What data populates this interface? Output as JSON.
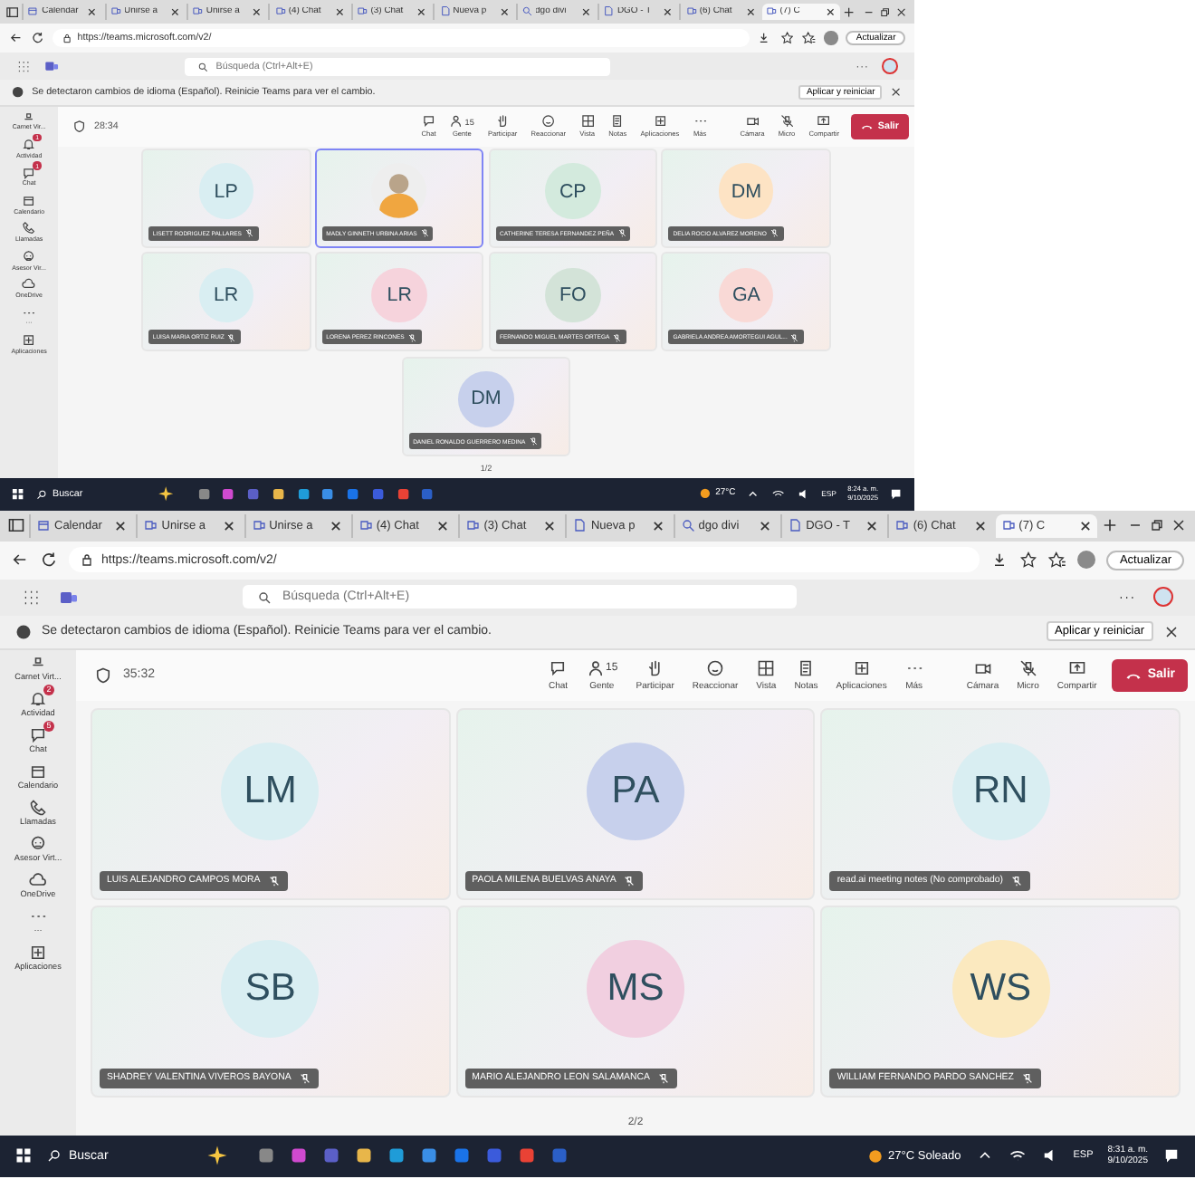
{
  "screens": [
    {
      "tabs": [
        {
          "label": "Calendar",
          "selected": false
        },
        {
          "label": "Unirse a",
          "selected": false
        },
        {
          "label": "Unirse a",
          "selected": false
        },
        {
          "label": "(4) Chat",
          "selected": false
        },
        {
          "label": "(3) Chat",
          "selected": false
        },
        {
          "label": "Nueva p",
          "selected": false
        },
        {
          "label": "dgo divi",
          "selected": false
        },
        {
          "label": "DGO - T",
          "selected": false
        },
        {
          "label": "(6) Chat",
          "selected": false
        },
        {
          "label": "(7) C",
          "selected": true
        }
      ],
      "url": "https://teams.microsoft.com/v2/",
      "update_button": "Actualizar",
      "search_placeholder": "Búsqueda (Ctrl+Alt+E)",
      "notice": "Se detectaron cambios de idioma (Español). Reinicie Teams para ver el cambio.",
      "notice_button": "Aplicar y reiniciar",
      "rail": [
        {
          "label": "Carnet Vir..."
        },
        {
          "label": "Actividad",
          "badge": "1"
        },
        {
          "label": "Chat",
          "badge": "1"
        },
        {
          "label": "Calendario"
        },
        {
          "label": "Llamadas"
        },
        {
          "label": "Asesor Vir..."
        },
        {
          "label": "OneDrive"
        },
        {
          "label": "···"
        },
        {
          "label": "Aplicaciones"
        }
      ],
      "timer": "28:34",
      "toolbar": [
        {
          "label": "Chat"
        },
        {
          "label": "Gente",
          "count": "15"
        },
        {
          "label": "Participar"
        },
        {
          "label": "Reaccionar"
        },
        {
          "label": "Vista"
        },
        {
          "label": "Notas"
        },
        {
          "label": "Aplicaciones"
        },
        {
          "label": "Más"
        },
        {
          "label": "Cámara"
        },
        {
          "label": "Micro"
        },
        {
          "label": "Compartir"
        }
      ],
      "leave_button": "Salir",
      "tiles": [
        {
          "kind": "initials",
          "initials": "LP",
          "name": "LISETT RODRIGUEZ PALLARES",
          "color": "#d9eef2",
          "selected": false
        },
        {
          "kind": "photo",
          "name": "MADLY GINNETH URBINA ARIAS",
          "color": "#f0a640",
          "selected": true
        },
        {
          "kind": "initials",
          "initials": "CP",
          "name": "CATHERINE TERESA FERNANDEZ PEÑA",
          "color": "#d3eadd",
          "selected": false
        },
        {
          "kind": "initials",
          "initials": "DM",
          "name": "DELIA ROCIO ALVAREZ MORENO",
          "color": "#fde3c4",
          "selected": false
        },
        {
          "kind": "initials",
          "initials": "LR",
          "name": "LUISA MARIA ORTIZ RUIZ",
          "color": "#d9eef2",
          "selected": false
        },
        {
          "kind": "initials",
          "initials": "LR",
          "name": "LORENA PEREZ RINCONES",
          "color": "#f6d3dc",
          "selected": false
        },
        {
          "kind": "initials",
          "initials": "FO",
          "name": "FERNANDO MIGUEL MARTES ORTEGA",
          "color": "#d3e3d8",
          "selected": false
        },
        {
          "kind": "initials",
          "initials": "GA",
          "name": "GABRIELA ANDREA AMORTEGUI AGUL...",
          "color": "#f9d9d6",
          "selected": false
        },
        {
          "kind": "initials",
          "initials": "DM",
          "name": "DANIEL RONALDO GUERRERO MEDINA",
          "color": "#c7d0ec",
          "selected": false
        }
      ],
      "pager": "1/2",
      "taskbar_search": "Buscar",
      "weather": "27°C",
      "language": "ESP",
      "time": "8:24 a. m.",
      "date": "9/10/2025"
    },
    {
      "tabs": [
        {
          "label": "Calendar",
          "selected": false
        },
        {
          "label": "Unirse a",
          "selected": false
        },
        {
          "label": "Unirse a",
          "selected": false
        },
        {
          "label": "(4) Chat",
          "selected": false
        },
        {
          "label": "(3) Chat",
          "selected": false
        },
        {
          "label": "Nueva p",
          "selected": false
        },
        {
          "label": "dgo divi",
          "selected": false
        },
        {
          "label": "DGO - T",
          "selected": false
        },
        {
          "label": "(6) Chat",
          "selected": false
        },
        {
          "label": "(7) C",
          "selected": true
        }
      ],
      "url": "https://teams.microsoft.com/v2/",
      "update_button": "Actualizar",
      "search_placeholder": "Búsqueda (Ctrl+Alt+E)",
      "notice": "Se detectaron cambios de idioma (Español). Reinicie Teams para ver el cambio.",
      "notice_button": "Aplicar y reiniciar",
      "rail": [
        {
          "label": "Carnet Virt..."
        },
        {
          "label": "Actividad",
          "badge": "2"
        },
        {
          "label": "Chat",
          "badge": "5"
        },
        {
          "label": "Calendario"
        },
        {
          "label": "Llamadas"
        },
        {
          "label": "Asesor Virt..."
        },
        {
          "label": "OneDrive"
        },
        {
          "label": "···"
        },
        {
          "label": "Aplicaciones"
        }
      ],
      "timer": "35:32",
      "toolbar": [
        {
          "label": "Chat"
        },
        {
          "label": "Gente",
          "count": "15"
        },
        {
          "label": "Participar"
        },
        {
          "label": "Reaccionar"
        },
        {
          "label": "Vista"
        },
        {
          "label": "Notas"
        },
        {
          "label": "Aplicaciones"
        },
        {
          "label": "Más"
        },
        {
          "label": "Cámara"
        },
        {
          "label": "Micro"
        },
        {
          "label": "Compartir"
        }
      ],
      "leave_button": "Salir",
      "tiles": [
        {
          "kind": "initials",
          "initials": "LM",
          "name": "LUIS ALEJANDRO CAMPOS MORA",
          "color": "#d9eef2",
          "selected": false
        },
        {
          "kind": "initials",
          "initials": "PA",
          "name": "PAOLA MILENA BUELVAS ANAYA",
          "color": "#c7d0ec",
          "selected": false
        },
        {
          "kind": "initials",
          "initials": "RN",
          "name": "read.ai meeting notes (No comprobado)",
          "color": "#d9eef2",
          "selected": false
        },
        {
          "kind": "initials",
          "initials": "SB",
          "name": "SHADREY VALENTINA VIVEROS BAYONA",
          "color": "#d9eef2",
          "selected": false
        },
        {
          "kind": "initials",
          "initials": "MS",
          "name": "MARIO ALEJANDRO LEON SALAMANCA",
          "color": "#f1cfe0",
          "selected": false
        },
        {
          "kind": "initials",
          "initials": "WS",
          "name": "WILLIAM FERNANDO PARDO SANCHEZ",
          "color": "#fbe9bf",
          "selected": false
        }
      ],
      "pager": "2/2",
      "taskbar_search": "Buscar",
      "weather": "27°C Soleado",
      "language": "ESP",
      "time": "8:31 a. m.",
      "date": "9/10/2025"
    }
  ]
}
